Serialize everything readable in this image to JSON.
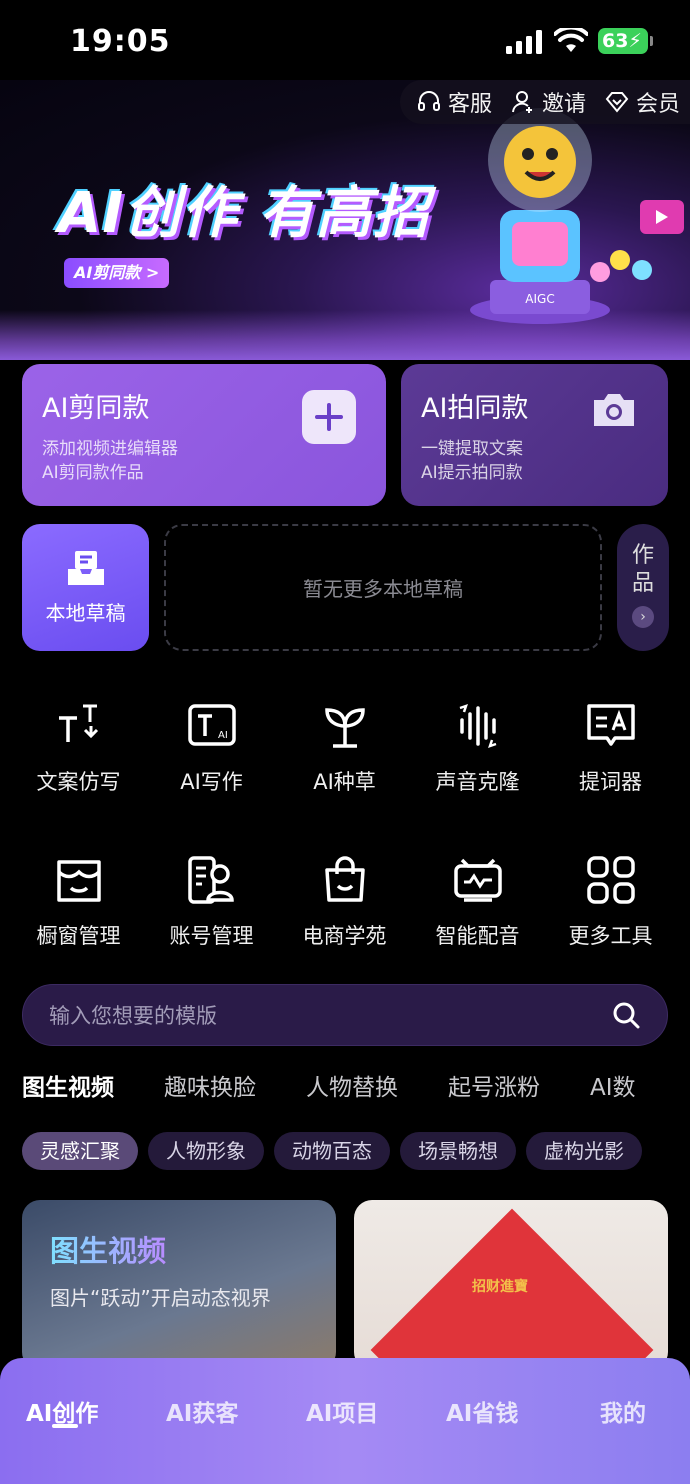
{
  "status_bar": {
    "time": "19:05",
    "battery": "63"
  },
  "top_nav": [
    {
      "label": "客服",
      "icon": "headset-icon"
    },
    {
      "label": "邀请",
      "icon": "person-add-icon"
    },
    {
      "label": "会员",
      "icon": "diamond-icon"
    }
  ],
  "banner": {
    "slogan": "AI创作 有高招",
    "tag": "AI剪同款 >",
    "badge": "AIGC"
  },
  "cards": {
    "cut": {
      "title": "AI剪同款",
      "desc1": "添加视频进编辑器",
      "desc2": "AI剪同款作品"
    },
    "shoot": {
      "title": "AI拍同款",
      "desc1": "一键提取文案",
      "desc2": "AI提示拍同款"
    }
  },
  "drafts": {
    "local_label": "本地草稿",
    "empty_text": "暂无更多本地草稿",
    "works_line1": "作",
    "works_line2": "品"
  },
  "tools": [
    {
      "label": "文案仿写",
      "icon": "text-rewrite-icon"
    },
    {
      "label": "AI写作",
      "icon": "ai-writing-icon"
    },
    {
      "label": "AI种草",
      "icon": "sprout-icon"
    },
    {
      "label": "声音克隆",
      "icon": "voice-clone-icon"
    },
    {
      "label": "提词器",
      "icon": "teleprompter-icon"
    },
    {
      "label": "橱窗管理",
      "icon": "storefront-icon"
    },
    {
      "label": "账号管理",
      "icon": "account-manage-icon"
    },
    {
      "label": "电商学苑",
      "icon": "shopping-bag-icon"
    },
    {
      "label": "智能配音",
      "icon": "smart-dubbing-icon"
    },
    {
      "label": "更多工具",
      "icon": "grid-more-icon"
    }
  ],
  "search": {
    "placeholder": "输入您想要的模版"
  },
  "category_tabs": [
    "图生视频",
    "趣味换脸",
    "人物替换",
    "起号涨粉",
    "AI数"
  ],
  "chips": [
    "灵感汇聚",
    "人物形象",
    "动物百态",
    "场景畅想",
    "虚构光影"
  ],
  "content_cards": {
    "left": {
      "title": "图生视频",
      "subtitle": "图片“跃动”开启动态视界"
    },
    "right": {
      "poster_text": "招财進寶"
    }
  },
  "tabbar": [
    "AI创作",
    "AI获客",
    "AI项目",
    "AI省钱",
    "我的"
  ],
  "colors": {
    "accent": "#9b63e8",
    "tabbar": "#9a80f2",
    "background": "#000000"
  }
}
